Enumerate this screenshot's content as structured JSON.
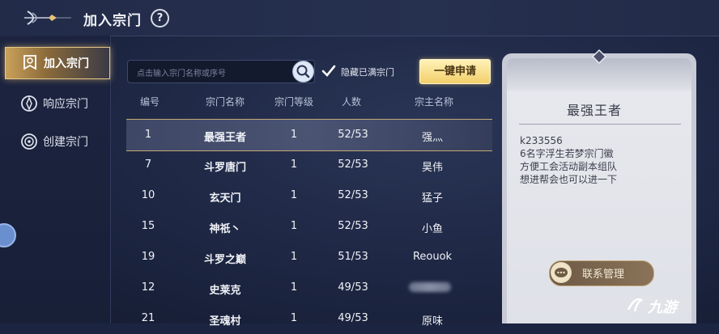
{
  "header": {
    "title": "加入宗门",
    "help_symbol": "?"
  },
  "sidebar": {
    "items": [
      {
        "label": "加入宗门",
        "icon": "banner-icon",
        "active": true
      },
      {
        "label": "响应宗门",
        "icon": "compass-icon",
        "active": false
      },
      {
        "label": "创建宗门",
        "icon": "target-icon",
        "active": false
      }
    ]
  },
  "search": {
    "placeholder": "点击输入宗门名称或序号",
    "hide_full_label": "隐藏已满宗门",
    "hide_full_checked": true
  },
  "apply_all_label": "一键申请",
  "table": {
    "headers": [
      "编号",
      "宗门名称",
      "宗门等级",
      "人数",
      "宗主名称"
    ],
    "rows": [
      {
        "id": "1",
        "name": "最强王者",
        "level": "1",
        "members": "52/53",
        "leader": "强灬"
      },
      {
        "id": "7",
        "name": "斗罗唐门",
        "level": "1",
        "members": "52/53",
        "leader": "昊伟"
      },
      {
        "id": "10",
        "name": "玄天门",
        "level": "1",
        "members": "52/53",
        "leader": "猛子"
      },
      {
        "id": "15",
        "name": "神祇丶",
        "level": "1",
        "members": "52/53",
        "leader": "小鱼"
      },
      {
        "id": "19",
        "name": "斗罗之巅",
        "level": "1",
        "members": "51/53",
        "leader": "Reouok"
      },
      {
        "id": "12",
        "name": "史莱克",
        "level": "1",
        "members": "49/53",
        "leader": ""
      },
      {
        "id": "21",
        "name": "圣魂村",
        "level": "1",
        "members": "49/53",
        "leader": "原味"
      }
    ]
  },
  "detail": {
    "title": "最强王者",
    "description": "k233556\n6名字浮生若梦宗门徽\n方便工会活动副本组队\n想进帮会也可以进一下",
    "contact_label": "联系管理"
  },
  "watermark": "九游",
  "colors": {
    "accent_gold": "#f2cf6a",
    "background": "#1b2440",
    "card": "#e8e9ee"
  }
}
